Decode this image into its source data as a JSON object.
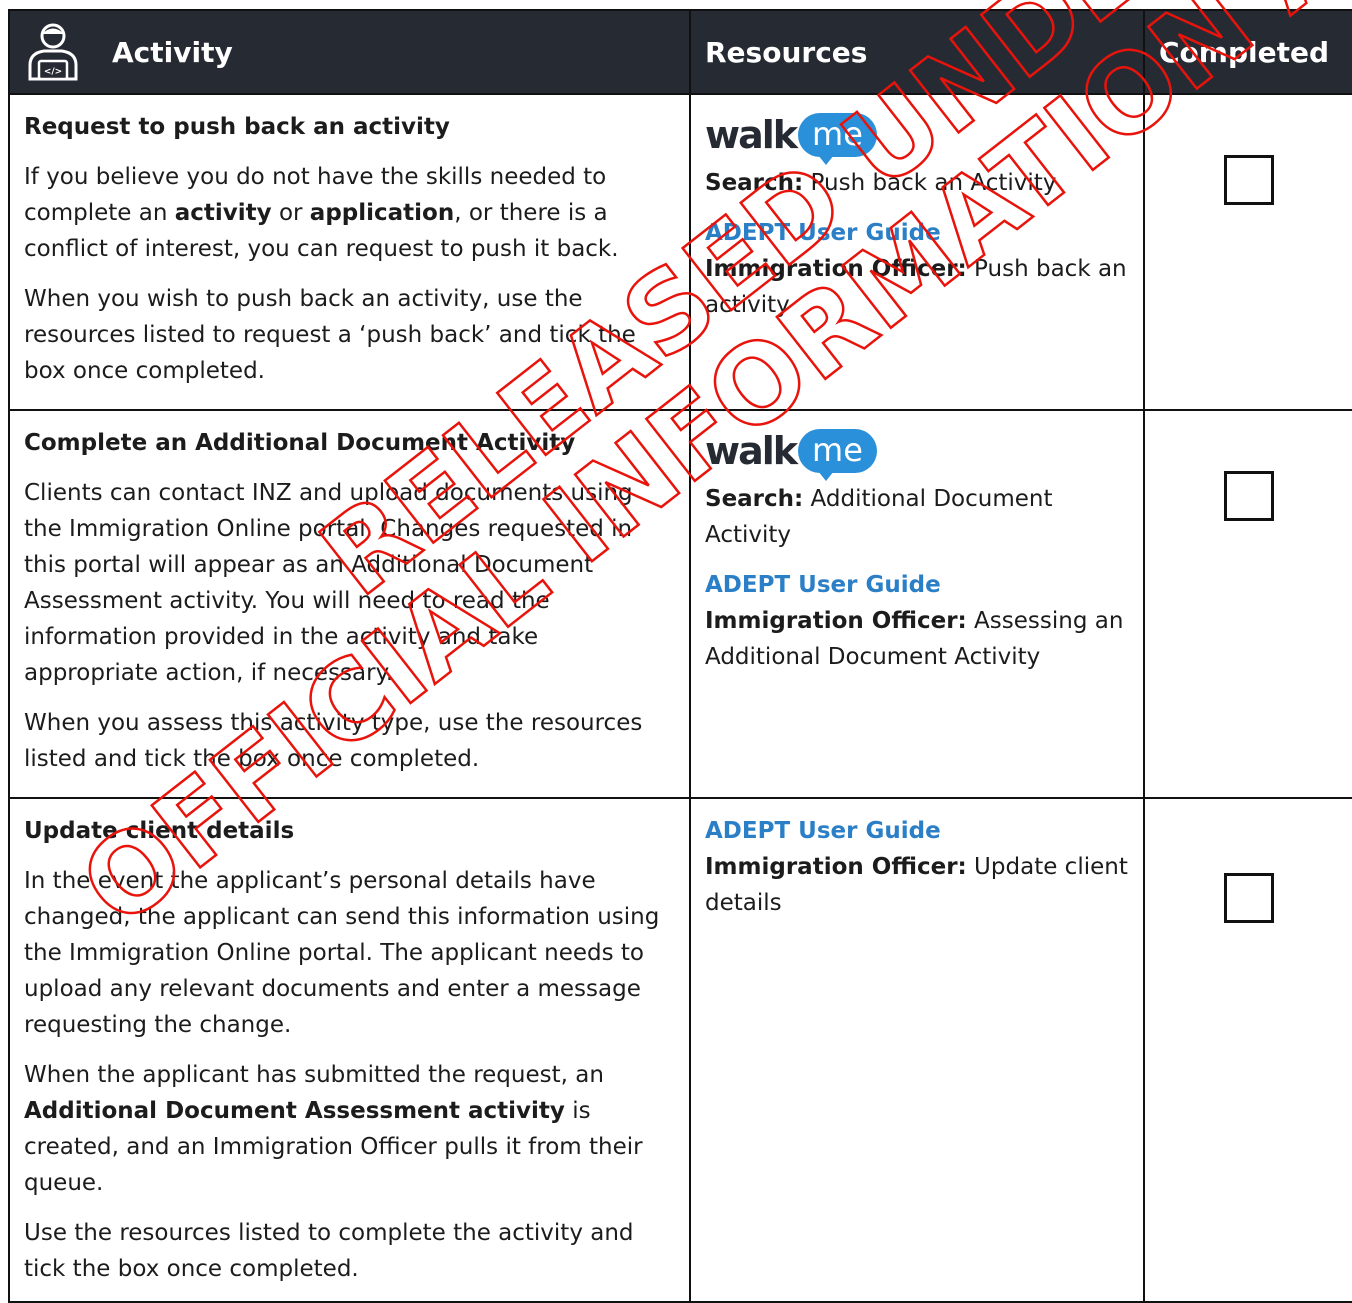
{
  "header": {
    "activity": "Activity",
    "resources": "Resources",
    "completed": "Completed",
    "icon": "user-code-icon"
  },
  "rows": [
    {
      "title": "Request to push back an activity",
      "p1": [
        "If you believe you do not have the skills needed to complete an ",
        "activity",
        " or ",
        "application",
        ", or there is a conflict of interest, you can request to push it back."
      ],
      "p2": "When you wish to push back an activity, use the resources listed to request a ‘push back’ and tick the box once completed.",
      "walkme": "walk",
      "walkme_bubble": "me",
      "search_label": "Search:",
      "search_value": " Push back an Activity",
      "guide": "ADEPT User Guide",
      "officer_label": "Immigration Officer:",
      "officer_value": " Push back an activity",
      "completed": false
    },
    {
      "title": "Complete an Additional Document Activity",
      "p1": "Clients can contact INZ and upload documents using the Immigration Online portal. Changes requested in this portal will appear as an Additional Document Assessment activity. You will need to read the information provided in the activity and take appropriate action, if necessary.",
      "p2": "When you assess this activity type, use the resources listed and tick the box once completed.",
      "walkme": "walk",
      "walkme_bubble": "me",
      "search_label": "Search:",
      "search_value": " Additional Document Activity",
      "guide": "ADEPT User Guide",
      "officer_label": "Immigration Officer:",
      "officer_value": " Assessing an Additional Document Activity",
      "completed": false
    },
    {
      "title": "Update client details",
      "p1": "In the event the applicant’s personal details have changed, the applicant can send this information using the Immigration Online portal. The applicant needs to upload any relevant documents and enter a message requesting the change.",
      "p2": [
        "When the applicant has submitted the request, an ",
        "Additional Document Assessment activity",
        " is created, and an Immigration Officer pulls it from their queue."
      ],
      "p3": "Use the resources listed to complete the activity and tick the box once completed.",
      "guide": "ADEPT User Guide",
      "officer_label": "Immigration Officer:",
      "officer_value": " Update client details",
      "completed": false
    }
  ],
  "watermark": {
    "line1": "RELEASED UNDER THE",
    "line2": "OFFICIAL INFORMATION ACT",
    "color": "#e8140c"
  }
}
